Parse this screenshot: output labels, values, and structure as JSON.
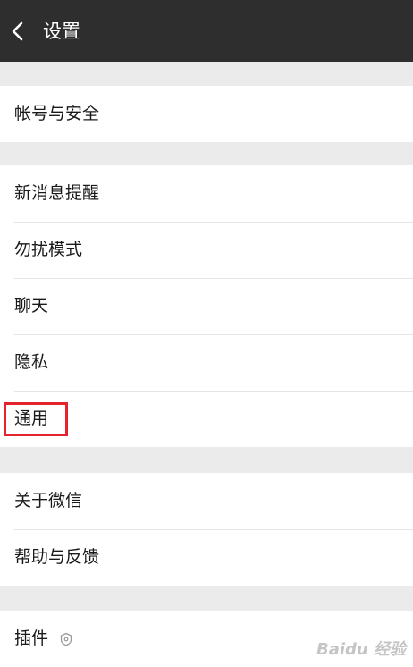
{
  "header": {
    "back_icon": "chevron-left-icon",
    "title": "设置"
  },
  "groups": [
    {
      "items": [
        {
          "label": "帐号与安全"
        }
      ]
    },
    {
      "items": [
        {
          "label": "新消息提醒"
        },
        {
          "label": "勿扰模式"
        },
        {
          "label": "聊天"
        },
        {
          "label": "隐私"
        },
        {
          "label": "通用",
          "highlighted": true
        }
      ]
    },
    {
      "items": [
        {
          "label": "关于微信"
        },
        {
          "label": "帮助与反馈"
        }
      ]
    },
    {
      "items": [
        {
          "label": "插件",
          "icon": "plugin-badge-icon"
        }
      ]
    }
  ],
  "highlight_color": "#e5232d",
  "watermark": "Baidu 经验"
}
